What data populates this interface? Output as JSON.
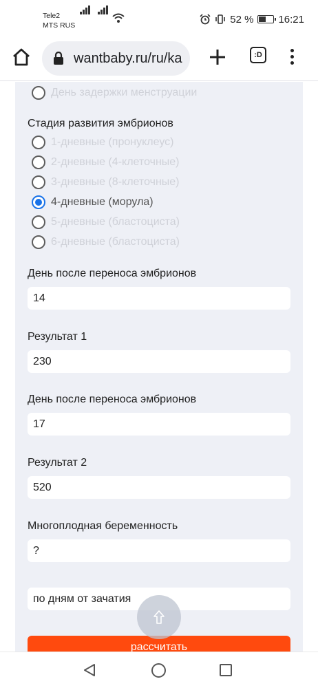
{
  "status_bar": {
    "carrier1": "Tele2",
    "carrier2": "MTS RUS",
    "battery_percent": "52 %",
    "battery_level": 0.52,
    "time": "16:21"
  },
  "browser": {
    "url": "wantbaby.ru/ru/ka",
    "tab_count_label": ":D"
  },
  "form": {
    "prev_option_label": "День задержки менструации",
    "stage_label": "Стадия развития эмбрионов",
    "stage_options": [
      {
        "label": "1-дневные (пронуклеус)",
        "checked": false
      },
      {
        "label": "2-дневные (4-клеточные)",
        "checked": false
      },
      {
        "label": "3-дневные (8-клеточные)",
        "checked": false
      },
      {
        "label": "4-дневные (морула)",
        "checked": true
      },
      {
        "label": "5-дневные (бластоциста)",
        "checked": false
      },
      {
        "label": "6-дневные (бластоциста)",
        "checked": false
      }
    ],
    "day1_label": "День после переноса эмбрионов",
    "day1_value": "14",
    "result1_label": "Результат 1",
    "result1_value": "230",
    "day2_label": "День после переноса эмбрионов",
    "day2_value": "17",
    "result2_label": "Результат 2",
    "result2_value": "520",
    "multiple_label": "Многоплодная беременность",
    "multiple_value": "?",
    "mode_value": "по дням от зачатия",
    "submit_label": "рассчитать"
  }
}
